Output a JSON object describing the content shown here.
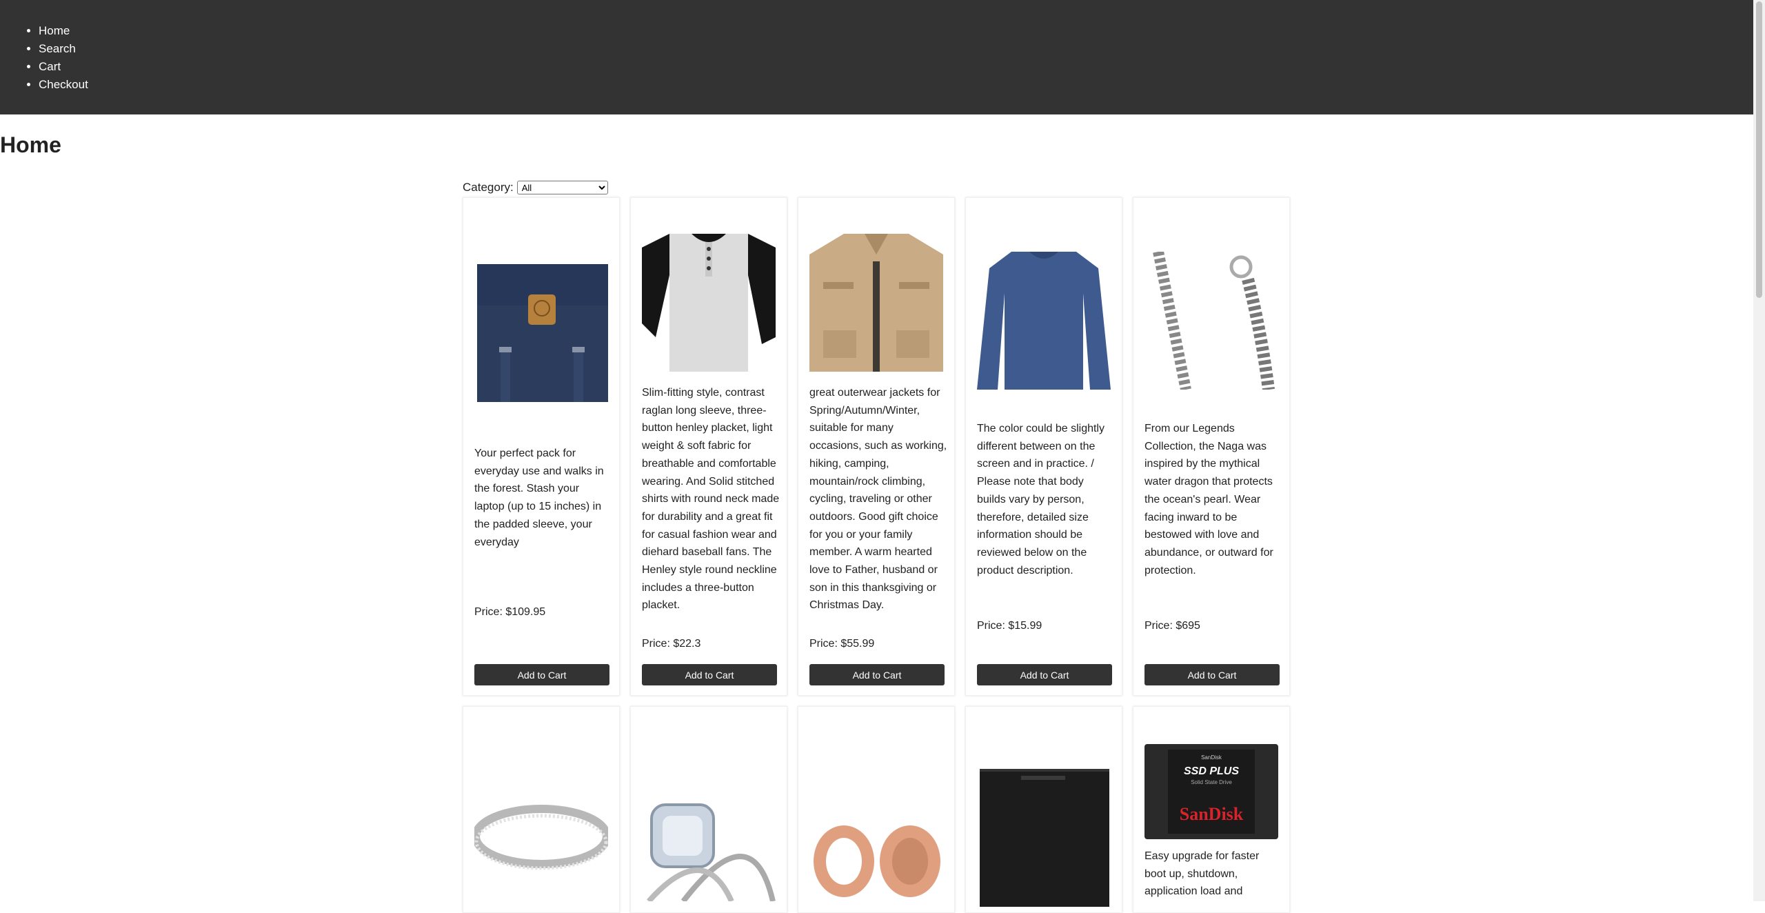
{
  "nav": {
    "items": [
      {
        "label": "Home"
      },
      {
        "label": "Search"
      },
      {
        "label": "Cart"
      },
      {
        "label": "Checkout"
      }
    ]
  },
  "page": {
    "title": "Home"
  },
  "filter": {
    "label": "Category:",
    "selected": "All"
  },
  "products": [
    {
      "description": "Your perfect pack for everyday use and walks in the forest. Stash your laptop (up to 15 inches) in the padded sleeve, your everyday",
      "price": "Price: $109.95",
      "button": "Add to Cart",
      "icon": "backpack-image"
    },
    {
      "description": "Slim-fitting style, contrast raglan long sleeve, three-button henley placket, light weight & soft fabric for breathable and comfortable wearing. And Solid stitched shirts with round neck made for durability and a great fit for casual fashion wear and diehard baseball fans. The Henley style round neckline includes a three-button placket.",
      "price": "Price: $22.3",
      "button": "Add to Cart",
      "icon": "henley-shirt-image"
    },
    {
      "description": "great outerwear jackets for Spring/Autumn/Winter, suitable for many occasions, such as working, hiking, camping, mountain/rock climbing, cycling, traveling or other outdoors. Good gift choice for you or your family member. A warm hearted love to Father, husband or son in this thanksgiving or Christmas Day.",
      "price": "Price: $55.99",
      "button": "Add to Cart",
      "icon": "jacket-image"
    },
    {
      "description": "The color could be slightly different between on the screen and in practice. / Please note that body builds vary by person, therefore, detailed size information should be reviewed below on the product description.",
      "price": "Price: $15.99",
      "button": "Add to Cart",
      "icon": "long-sleeve-shirt-image"
    },
    {
      "description": "From our Legends Collection, the Naga was inspired by the mythical water dragon that protects the ocean's pearl. Wear facing inward to be bestowed with love and abundance, or outward for protection.",
      "price": "Price: $695",
      "button": "Add to Cart",
      "icon": "chain-bracelet-image"
    },
    {
      "description": "",
      "price": "",
      "button": "",
      "icon": "band-ring-image"
    },
    {
      "description": "",
      "price": "",
      "button": "",
      "icon": "engagement-ring-image"
    },
    {
      "description": "",
      "price": "",
      "button": "",
      "icon": "ear-plugs-image"
    },
    {
      "description": "",
      "price": "",
      "button": "",
      "icon": "hard-drive-image"
    },
    {
      "description": "Easy upgrade for faster boot up, shutdown, application load and",
      "price": "",
      "button": "",
      "icon": "ssd-image",
      "ssd_brand_top": "SanDisk",
      "ssd_model": "SSD PLUS",
      "ssd_sub": "Solid State Drive",
      "ssd_brand": "SanDisk"
    }
  ],
  "colors": {
    "topbar": "#333333",
    "button": "#333333"
  }
}
